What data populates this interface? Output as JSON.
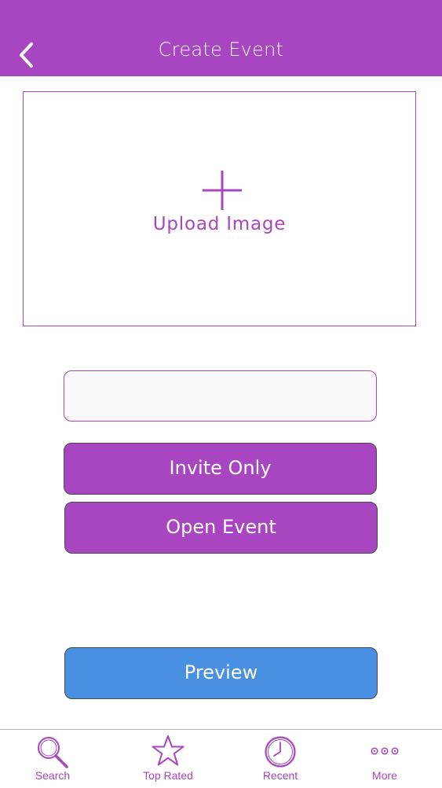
{
  "header": {
    "title": "Create Event"
  },
  "upload": {
    "label": "Upload Image"
  },
  "form": {
    "event_name_value": "",
    "event_name_placeholder": ""
  },
  "buttons": {
    "invite_only": "Invite Only",
    "open_event": "Open Event",
    "preview": "Preview"
  },
  "tabs": [
    {
      "label": "Search",
      "icon": "search-icon"
    },
    {
      "label": "Top Rated",
      "icon": "star-icon"
    },
    {
      "label": "Recent",
      "icon": "clock-icon"
    },
    {
      "label": "More",
      "icon": "more-icon"
    }
  ],
  "colors": {
    "accent": "#a845c0",
    "preview": "#4a90e2",
    "button_border": "#4a4a4a"
  }
}
